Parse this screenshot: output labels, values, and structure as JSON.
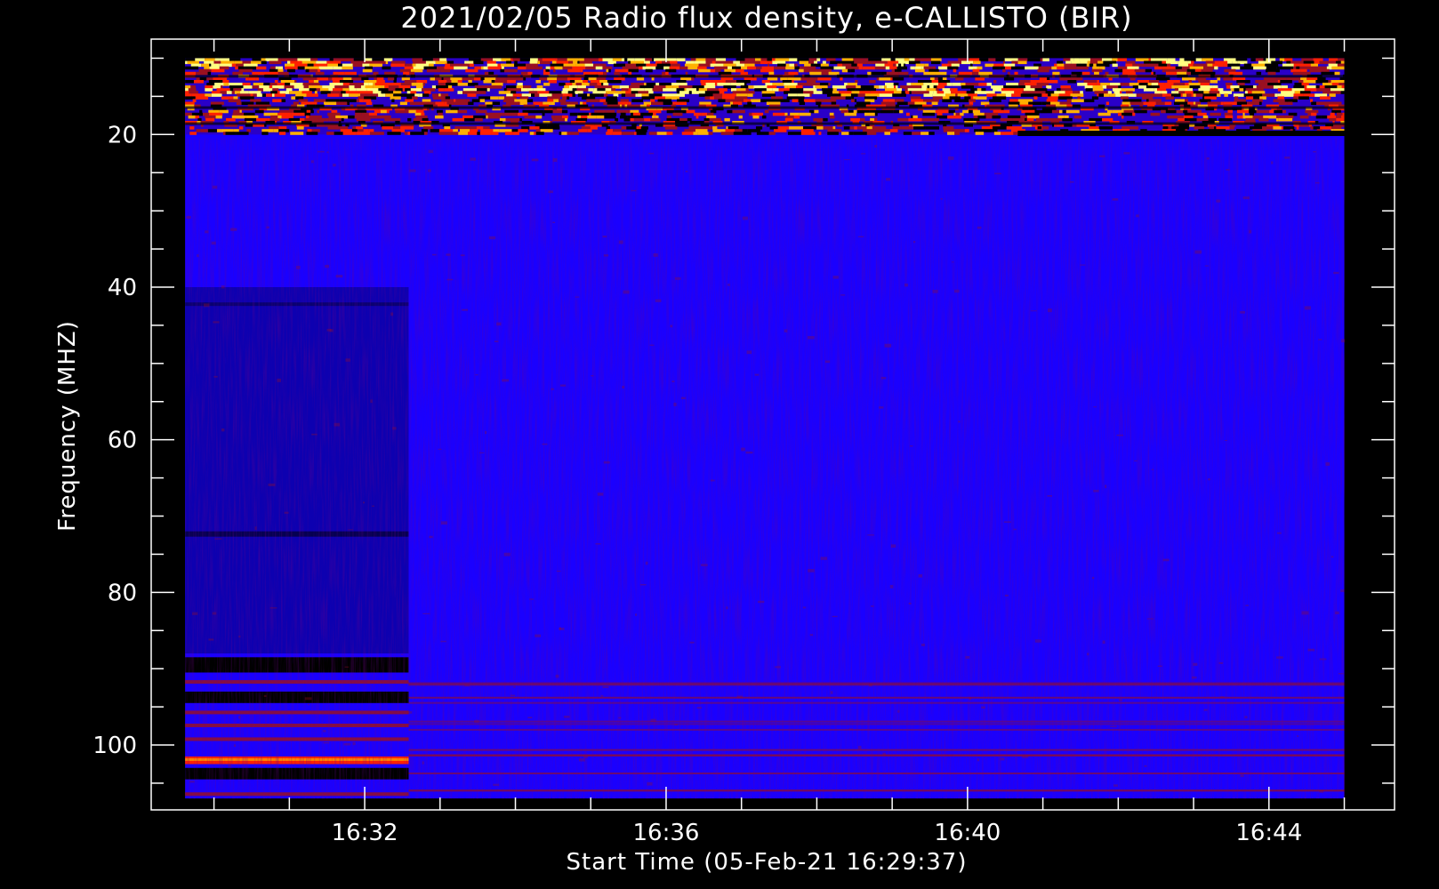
{
  "chart_data": {
    "type": "heatmap",
    "title": "2021/02/05  Radio flux density, e-CALLISTO (BIR)",
    "xlabel": "Start Time (05-Feb-21 16:29:37)",
    "ylabel": "Frequency (MHZ)",
    "x_unit": "time (HH:MM)",
    "y_unit": "MHz",
    "xlim": [
      "16:29:10",
      "16:45:40"
    ],
    "data_xrange": [
      "16:29:37",
      "16:45:00"
    ],
    "ylim": [
      108.5,
      7.5
    ],
    "data_yrange": [
      10,
      107
    ],
    "y_inverted": true,
    "xticks": [
      {
        "label": "16:32",
        "t": "16:32:00"
      },
      {
        "label": "16:36",
        "t": "16:36:00"
      },
      {
        "label": "16:40",
        "t": "16:40:00"
      },
      {
        "label": "16:44",
        "t": "16:44:00"
      }
    ],
    "yticks": [
      20,
      40,
      60,
      80,
      100
    ],
    "background_level": "low (blue)",
    "colormap": [
      "#000000",
      "#1a00ff",
      "#9a1020",
      "#ff2000",
      "#ffb000",
      "#ffff80"
    ],
    "features": [
      {
        "desc": "intense bursty emission / RFI",
        "freq_MHz": [
          10,
          20
        ],
        "time": [
          "16:29:37",
          "16:45:00"
        ]
      },
      {
        "desc": "dark lower-gain band",
        "freq_MHz": [
          40,
          88
        ],
        "time": [
          "16:29:37",
          "16:32:35"
        ]
      },
      {
        "desc": "no-data (black) bands",
        "freq_MHz": [
          [
            88.5,
            90.5
          ],
          [
            93,
            94.5
          ],
          [
            103,
            104.5
          ]
        ],
        "time": [
          "16:29:37",
          "16:32:35"
        ]
      },
      {
        "desc": "strong RFI line (red/orange)",
        "freq_MHz": [
          101.5,
          102.5
        ],
        "time": [
          "16:29:37",
          "16:32:35"
        ]
      },
      {
        "desc": "faint horizontal RFI streaks",
        "freq_MHz": [
          91,
          106
        ],
        "time": [
          "16:32:35",
          "16:45:00"
        ]
      },
      {
        "desc": "black gap at top band",
        "freq_MHz": [
          19.5,
          20
        ],
        "time": [
          "16:40:40",
          "16:45:00"
        ]
      }
    ],
    "grid": false,
    "legend": "none"
  }
}
